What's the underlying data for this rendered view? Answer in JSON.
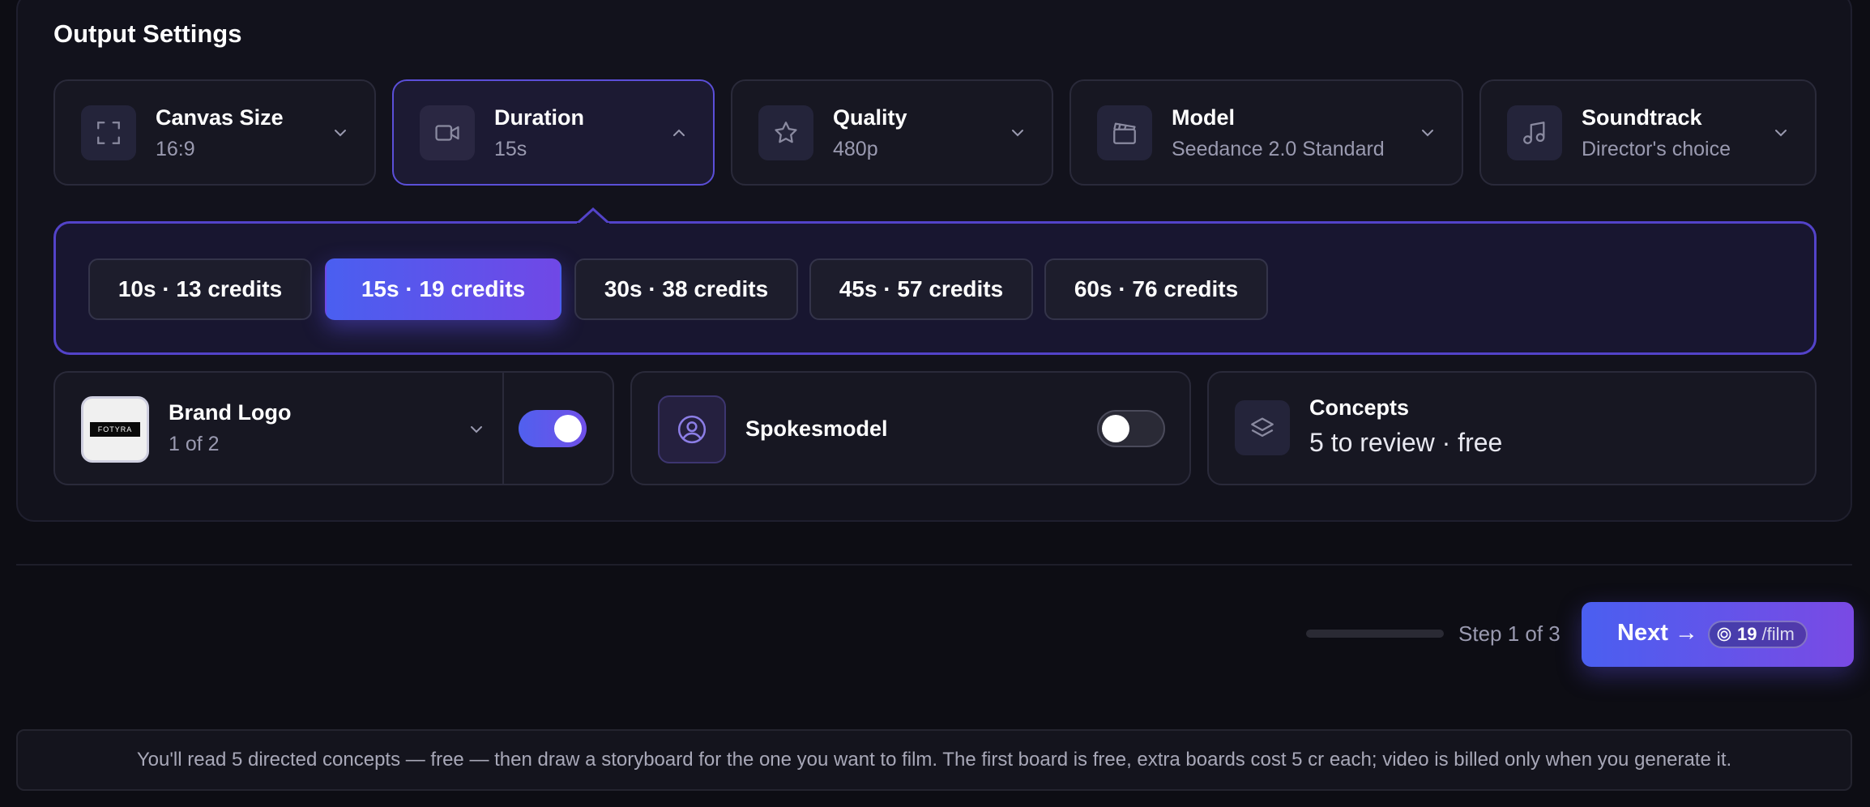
{
  "section_title": "Output Settings",
  "settings": [
    {
      "label": "Canvas Size",
      "value": "16:9",
      "icon": "expand-icon"
    },
    {
      "label": "Duration",
      "value": "15s",
      "icon": "video-camera-icon"
    },
    {
      "label": "Quality",
      "value": "480p",
      "icon": "star-icon"
    },
    {
      "label": "Model",
      "value": "Seedance 2.0 Standard",
      "icon": "clapperboard-icon"
    },
    {
      "label": "Soundtrack",
      "value": "Director's choice",
      "icon": "music-note-icon"
    }
  ],
  "duration_options": [
    {
      "label": "10s · 13 credits",
      "selected": false
    },
    {
      "label": "15s · 19 credits",
      "selected": true
    },
    {
      "label": "30s · 38 credits",
      "selected": false
    },
    {
      "label": "45s · 57 credits",
      "selected": false
    },
    {
      "label": "60s · 76 credits",
      "selected": false
    }
  ],
  "brand_logo": {
    "label": "Brand Logo",
    "value": "1 of 2",
    "logo_text": "FOTYRA",
    "enabled": true
  },
  "spokesmodel": {
    "label": "Spokesmodel",
    "enabled": false
  },
  "concepts": {
    "label": "Concepts",
    "value": "5 to review · free"
  },
  "footer_nav": {
    "step_text": "Step 1 of 3",
    "next_label": "Next →",
    "credits": "19",
    "credits_unit": "/film"
  },
  "note": "You'll read 5 directed concepts — free — then draw a storyboard for the one you want to film. The first board is free, extra boards cost 5 cr each; video is billed only when you generate it.",
  "colors": {
    "accent": "#5b4fd8",
    "accent_gradient_start": "#4a5ff0",
    "accent_gradient_end": "#7048e6",
    "background": "#0d0d14"
  }
}
